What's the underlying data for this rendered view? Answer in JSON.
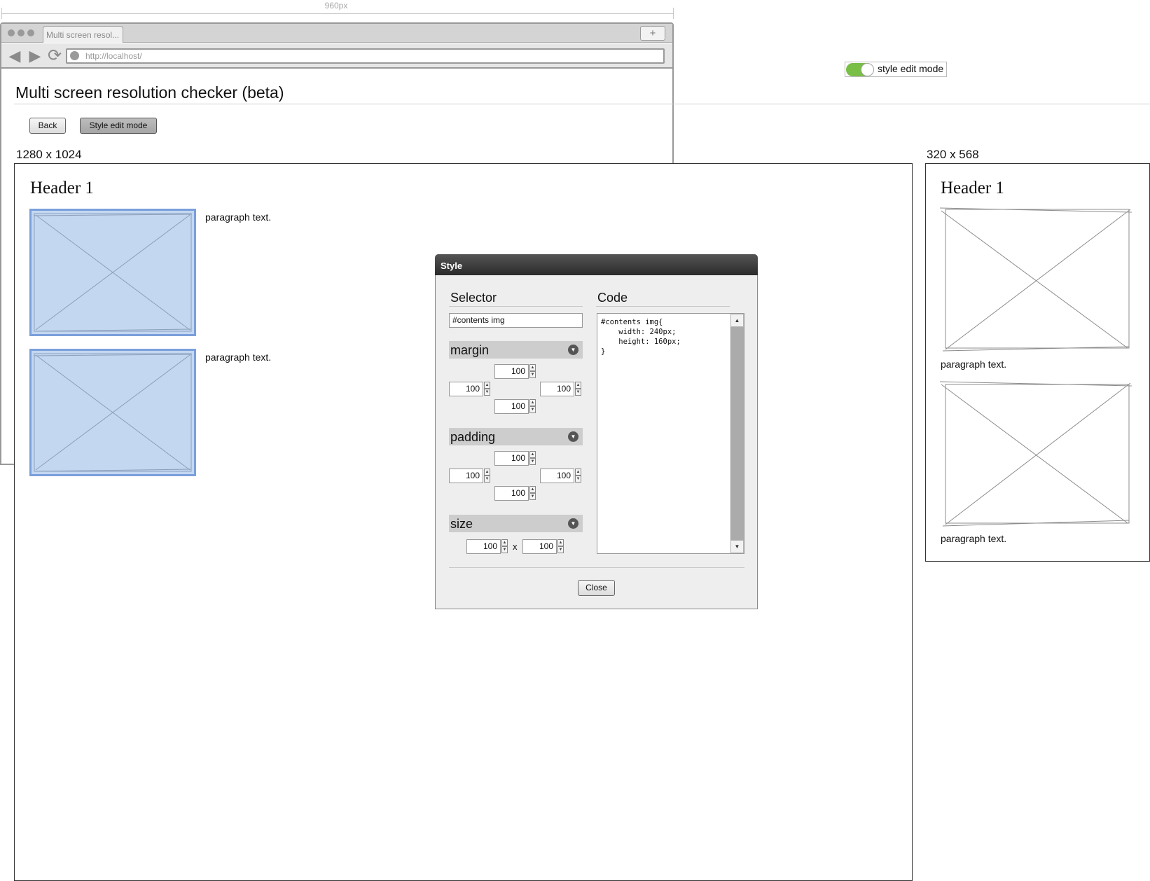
{
  "ruler": {
    "label": "960px"
  },
  "browser": {
    "tab_title": "Multi screen resol...",
    "new_tab_label": "+",
    "back_glyph": "◀",
    "forward_glyph": "▶",
    "reload_glyph": "⟳",
    "url": "http://localhost/"
  },
  "page": {
    "title": "Multi screen resolution checker (beta)",
    "back_button": "Back",
    "style_edit_button": "Style edit mode"
  },
  "toggle": {
    "label": "style edit mode",
    "on": true,
    "color": "#79be47"
  },
  "screens": [
    {
      "resolution": "1280 x 1024",
      "header": "Header 1",
      "items": [
        {
          "text": "paragraph text.",
          "selected": true
        },
        {
          "text": "paragraph text.",
          "selected": true
        }
      ]
    },
    {
      "resolution": "320 x 568",
      "header": "Header 1",
      "items": [
        {
          "text": "paragraph text.",
          "selected": false
        },
        {
          "text": "paragraph text.",
          "selected": false
        }
      ]
    }
  ],
  "dialog": {
    "title": "Style",
    "selector_heading": "Selector",
    "selector_value": "#contents img",
    "code_heading": "Code",
    "code": "#contents img{\n    width: 240px;\n    height: 160px;\n}",
    "margin": {
      "label": "margin",
      "top": "100",
      "left": "100",
      "right": "100",
      "bottom": "100"
    },
    "padding": {
      "label": "padding",
      "top": "100",
      "left": "100",
      "right": "100",
      "bottom": "100"
    },
    "size": {
      "label": "size",
      "width": "100",
      "height": "100",
      "separator": "x"
    },
    "close_button": "Close",
    "chevron_glyph": "▼",
    "spin_up_glyph": "▲",
    "spin_down_glyph": "▼"
  },
  "colors": {
    "selection_fill": "#c4d7f0",
    "selection_border": "#7aa0db",
    "title_bar": "#2a2a2a"
  }
}
